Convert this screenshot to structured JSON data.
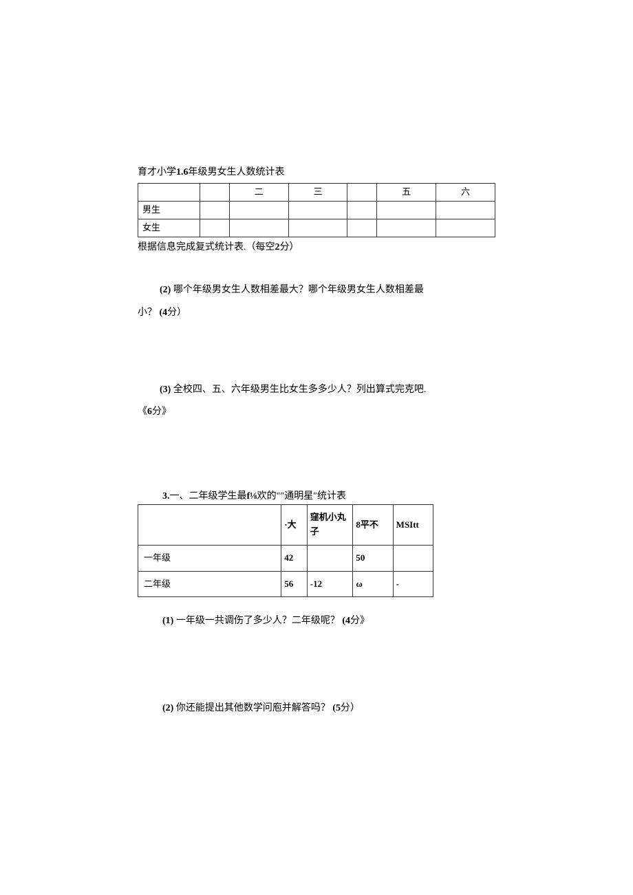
{
  "section2": {
    "title_prefix": "育才小学",
    "title_bold": "1.6",
    "title_suffix": "年级男女生人数统计表",
    "table": {
      "headers": [
        "",
        "",
        "二",
        "三",
        "",
        "五",
        "六"
      ],
      "rows": [
        {
          "label": "男生",
          "cells": [
            "",
            "",
            "",
            "",
            "",
            ""
          ]
        },
        {
          "label": "女生",
          "cells": [
            "",
            "",
            "",
            "",
            "",
            ""
          ]
        }
      ]
    },
    "instruction_text": "根据信息完成复式统计表.（每空",
    "instruction_bold": "2",
    "instruction_suffix": "分）",
    "q2_num": "(2)",
    "q2_text": " 哪个年级男女生人数相差最大？哪个年级男女生人数相差最",
    "q2_line2": "小？ ",
    "q2_score": "(4",
    "q2_score_suffix": "分）",
    "q3_num": "(3)",
    "q3_text": " 全校四、五、六年级男生比女生多多少人？列出算式完克吧.",
    "q3_line2": "《",
    "q3_score": "6",
    "q3_score_suffix": "分》"
  },
  "section3": {
    "title_num": "3.",
    "title_text": "一、二年级学生最",
    "title_bold1": "f⅛",
    "title_mid": "欢的\"″通明星″统计表",
    "table": {
      "headers": [
        "",
        "·大",
        "窪机小丸子",
        "8平不",
        "MSItt"
      ],
      "rows": [
        {
          "label": "一年级",
          "cells": [
            "42",
            "",
            "50",
            ""
          ]
        },
        {
          "label": "二年级",
          "cells": [
            "56",
            "-12",
            "ω",
            "-"
          ]
        }
      ]
    },
    "q1_num": "(1)",
    "q1_text": " 一年级一共调伤了多少人？二年级呢？ ",
    "q1_score": "(4",
    "q1_score_suffix": "分》",
    "q2_num": "(2)",
    "q2_text": " 你还能提出其他数学问庖并解答吗？ ",
    "q2_score": "(5",
    "q2_score_suffix": "分）"
  }
}
